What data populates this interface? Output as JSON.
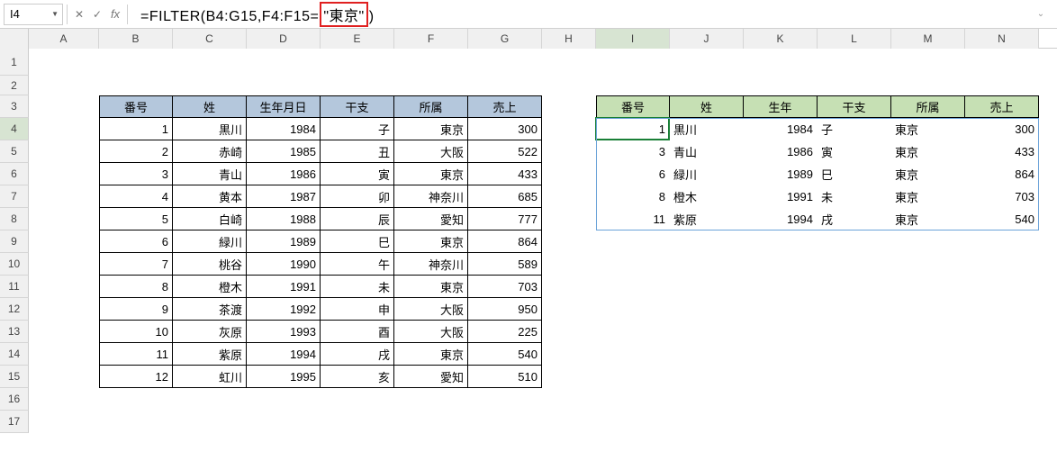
{
  "name_box": "I4",
  "formula": {
    "prefix": "=FILTER(B4:G15,F4:F15=",
    "highlight": "\"東京\"",
    "suffix": ")"
  },
  "columns": [
    "A",
    "B",
    "C",
    "D",
    "E",
    "F",
    "G",
    "H",
    "I",
    "J",
    "K",
    "L",
    "M",
    "N"
  ],
  "rows": [
    "1",
    "2",
    "3",
    "4",
    "5",
    "6",
    "7",
    "8",
    "9",
    "10",
    "11",
    "12",
    "13",
    "14",
    "15",
    "16",
    "17"
  ],
  "source": {
    "headers": [
      "番号",
      "姓",
      "生年月日",
      "干支",
      "所属",
      "売上"
    ],
    "rows": [
      {
        "no": "1",
        "name": "黒川",
        "year": "1984",
        "eto": "子",
        "loc": "東京",
        "sales": "300"
      },
      {
        "no": "2",
        "name": "赤崎",
        "year": "1985",
        "eto": "丑",
        "loc": "大阪",
        "sales": "522"
      },
      {
        "no": "3",
        "name": "青山",
        "year": "1986",
        "eto": "寅",
        "loc": "東京",
        "sales": "433"
      },
      {
        "no": "4",
        "name": "黄本",
        "year": "1987",
        "eto": "卯",
        "loc": "神奈川",
        "sales": "685"
      },
      {
        "no": "5",
        "name": "白崎",
        "year": "1988",
        "eto": "辰",
        "loc": "愛知",
        "sales": "777"
      },
      {
        "no": "6",
        "name": "緑川",
        "year": "1989",
        "eto": "巳",
        "loc": "東京",
        "sales": "864"
      },
      {
        "no": "7",
        "name": "桃谷",
        "year": "1990",
        "eto": "午",
        "loc": "神奈川",
        "sales": "589"
      },
      {
        "no": "8",
        "name": "橙木",
        "year": "1991",
        "eto": "未",
        "loc": "東京",
        "sales": "703"
      },
      {
        "no": "9",
        "name": "茶渡",
        "year": "1992",
        "eto": "申",
        "loc": "大阪",
        "sales": "950"
      },
      {
        "no": "10",
        "name": "灰原",
        "year": "1993",
        "eto": "酉",
        "loc": "大阪",
        "sales": "225"
      },
      {
        "no": "11",
        "name": "紫原",
        "year": "1994",
        "eto": "戌",
        "loc": "東京",
        "sales": "540"
      },
      {
        "no": "12",
        "name": "虹川",
        "year": "1995",
        "eto": "亥",
        "loc": "愛知",
        "sales": "510"
      }
    ]
  },
  "result": {
    "headers": [
      "番号",
      "姓",
      "生年",
      "干支",
      "所属",
      "売上"
    ],
    "rows": [
      {
        "no": "1",
        "name": "黒川",
        "year": "1984",
        "eto": "子",
        "loc": "東京",
        "sales": "300"
      },
      {
        "no": "3",
        "name": "青山",
        "year": "1986",
        "eto": "寅",
        "loc": "東京",
        "sales": "433"
      },
      {
        "no": "6",
        "name": "緑川",
        "year": "1989",
        "eto": "巳",
        "loc": "東京",
        "sales": "864"
      },
      {
        "no": "8",
        "name": "橙木",
        "year": "1991",
        "eto": "未",
        "loc": "東京",
        "sales": "703"
      },
      {
        "no": "11",
        "name": "紫原",
        "year": "1994",
        "eto": "戌",
        "loc": "東京",
        "sales": "540"
      }
    ]
  }
}
